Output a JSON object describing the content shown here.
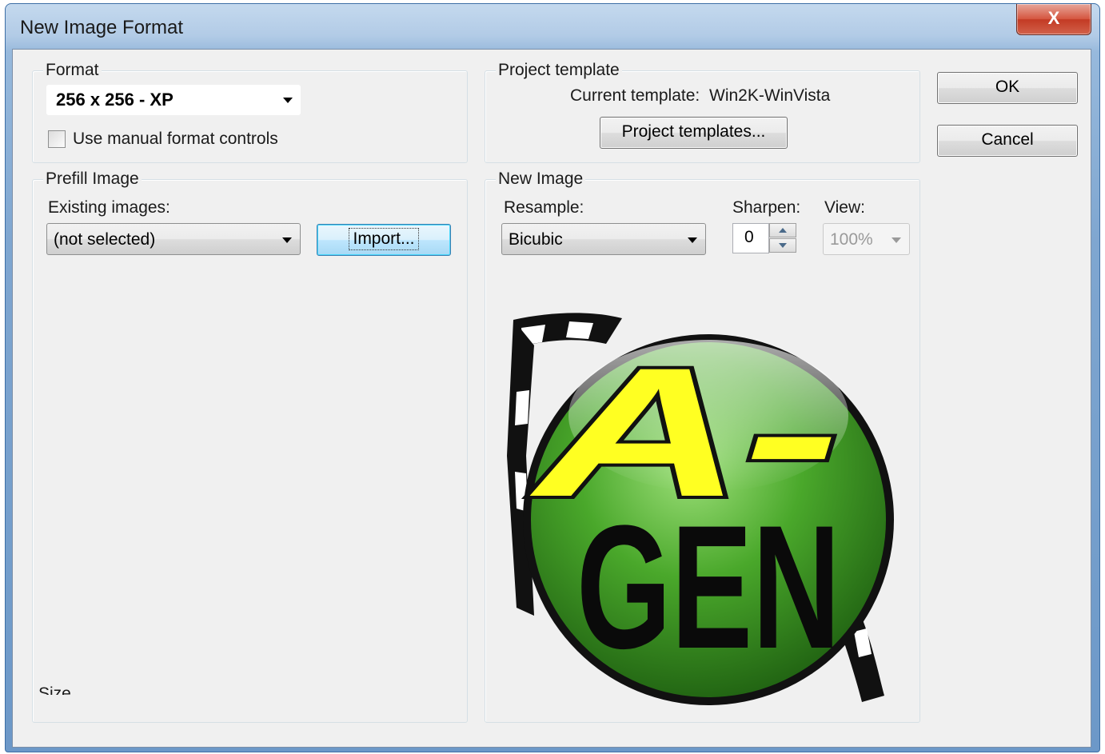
{
  "window": {
    "title": "New Image Format",
    "close_glyph": "X"
  },
  "format": {
    "group_label": "Format",
    "selected": "256 x 256 - XP",
    "manual_checkbox_label": "Use manual format controls",
    "manual_checked": false
  },
  "project_template": {
    "group_label": "Project template",
    "current_label": "Current template:",
    "current_value": "Win2K-WinVista",
    "button_label": "Project templates..."
  },
  "buttons": {
    "ok": "OK",
    "cancel": "Cancel"
  },
  "prefill": {
    "group_label": "Prefill Image",
    "existing_label": "Existing images:",
    "existing_selected": "(not selected)",
    "import_label": "Import..."
  },
  "new_image": {
    "group_label": "New Image",
    "resample_label": "Resample:",
    "resample_selected": "Bicubic",
    "sharpen_label": "Sharpen:",
    "sharpen_value": "0",
    "view_label": "View:",
    "view_selected": "100%",
    "preview_text_top": "A-",
    "preview_text_bottom": "GEN"
  },
  "size": {
    "group_label": "Size"
  },
  "colors": {
    "logo_green": "#3f9a24",
    "logo_yellow": "#ffff22",
    "title_gradient": "#b2cbe6"
  }
}
